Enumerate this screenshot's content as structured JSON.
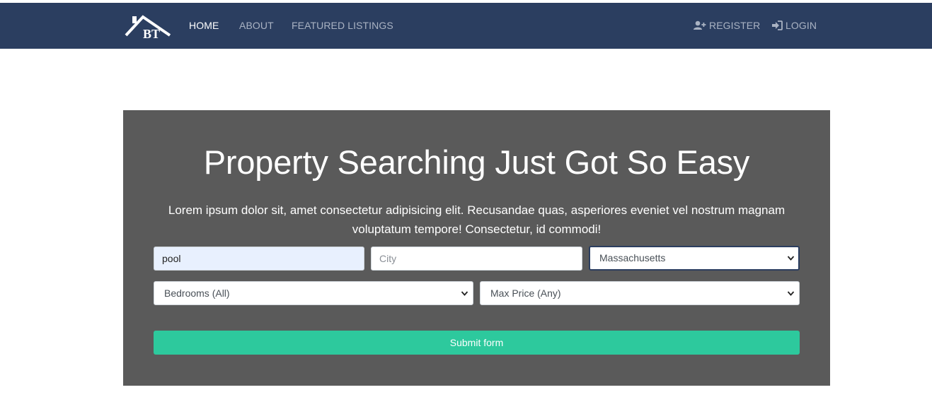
{
  "nav": {
    "logo_text": "BT",
    "links": [
      {
        "label": "HOME",
        "active": true
      },
      {
        "label": "ABOUT",
        "active": false
      },
      {
        "label": "FEATURED LISTINGS",
        "active": false
      }
    ],
    "register_label": "REGISTER",
    "login_label": "LOGIN",
    "icons": {
      "register": "user-plus-icon",
      "login": "sign-in-icon"
    }
  },
  "hero": {
    "title": "Property Searching Just Got So Easy",
    "text": "Lorem ipsum dolor sit, amet consectetur adipisicing elit. Recusandae quas, asperiores eveniet vel nostrum magnam voluptatum tempore! Consectetur, id commodi!"
  },
  "search": {
    "keywords_value": "pool",
    "city_placeholder": "City",
    "state_selected": "Massachusetts",
    "bedrooms_selected": "Bedrooms (All)",
    "max_price_selected": "Max Price (Any)",
    "submit_label": "Submit form"
  },
  "colors": {
    "navbar": "#2b3e60",
    "hero_bg": "#5a5a5a",
    "submit": "#2dc99d",
    "autofill": "#e8f0fe"
  }
}
